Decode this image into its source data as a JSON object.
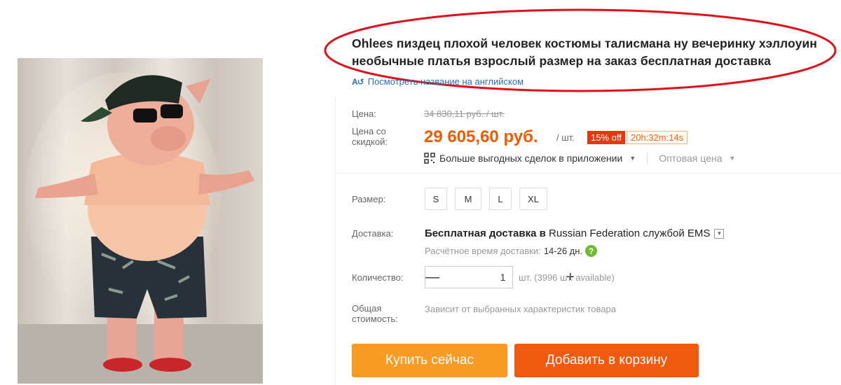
{
  "product": {
    "title": "Ohlees пиздец плохой человек костюмы талисмана ну вечеринку хэллоуин необычные платья взрослый размер на заказ бесплатная доставка",
    "translate_link": "Посмотреть название на английском",
    "image_icon": "pig-mascot-costume-photo"
  },
  "price": {
    "price_label": "Цена:",
    "old_price": "34 830,11 руб. / шт.",
    "discount_label": "Цена со скидкой:",
    "new_price": "29 605,60 руб.",
    "unit": "/ шт.",
    "discount_badge": "15% off",
    "timer": "20h:32m:14s",
    "app_deals": "Больше выгодных сделок в приложении",
    "wholesale": "Оптовая цена"
  },
  "size": {
    "label": "Размер:",
    "options": [
      "S",
      "M",
      "L",
      "XL"
    ]
  },
  "delivery": {
    "label": "Доставка:",
    "prefix": "Бесплатная доставка в",
    "country": "Russian Federation",
    "service_text": "службой EMS",
    "estimate_label": "Расчётное время доставки:",
    "estimate_days": "14-26 дн."
  },
  "quantity": {
    "label": "Количество:",
    "value": "1",
    "minus": "—",
    "plus": "+",
    "available": "шт. (3996 шт. available)"
  },
  "total": {
    "label": "Общая стоимость:",
    "value": "Зависит от выбранных характеристик товара"
  },
  "buttons": {
    "buy_now": "Купить сейчас",
    "add_to_cart": "Добавить в корзину"
  },
  "colors": {
    "accent_orange": "#f05a00",
    "buy_button": "#f89a23",
    "cart_button": "#f05a0e",
    "discount_badge": "#e4380f",
    "annotation_ellipse": "#e0101a",
    "link_blue": "#2a6ebb"
  }
}
